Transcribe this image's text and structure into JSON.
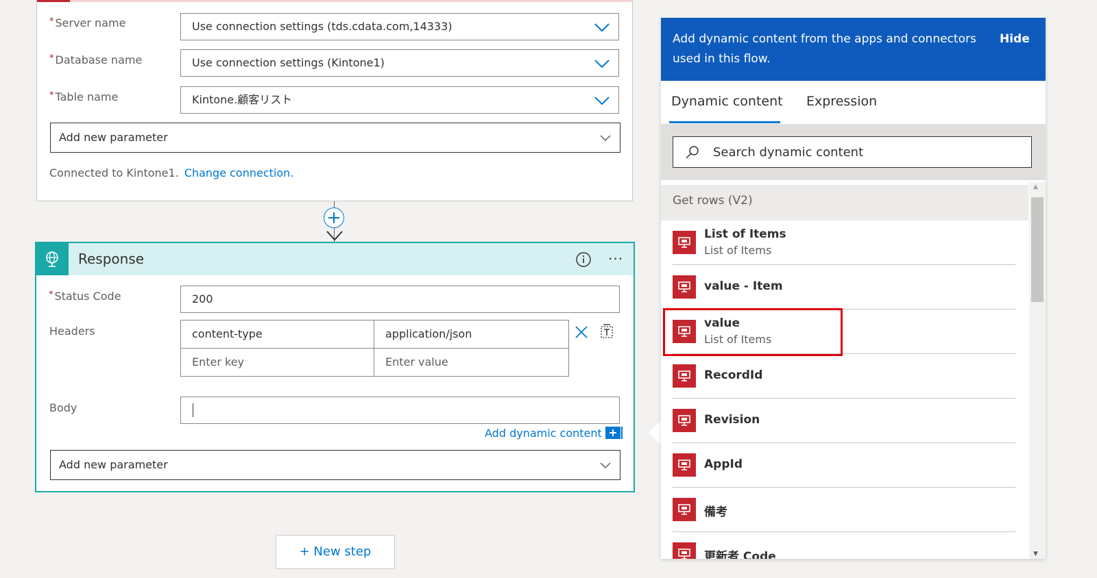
{
  "get_rows_card": {
    "server_label": "Server name",
    "server_value": "Use connection settings (tds.cdata.com,14333)",
    "database_label": "Database name",
    "database_value": "Use connection settings (Kintone1)",
    "table_label": "Table name",
    "table_value": "Kintone.顧客リスト",
    "add_param": "Add new parameter",
    "connected_text": "Connected to Kintone1.",
    "change_connection": "Change connection.",
    "required_mark": "*"
  },
  "response_card": {
    "title": "Response",
    "more": "···",
    "status_label": "Status Code",
    "status_value": "200",
    "headers_label": "Headers",
    "header_key": "content-type",
    "header_value": "application/json",
    "key_placeholder": "Enter key",
    "value_placeholder": "Enter value",
    "body_label": "Body",
    "add_dynamic": "Add dynamic content",
    "add_param": "Add new parameter",
    "required_mark": "*"
  },
  "new_step": "+ New step",
  "panel": {
    "description": "Add dynamic content from the apps and connectors used in this flow.",
    "hide": "Hide",
    "tabs": [
      "Dynamic content",
      "Expression"
    ],
    "search_placeholder": "Search dynamic content",
    "group_title": "Get rows (V2)",
    "items": [
      {
        "title": "List of Items",
        "subtitle": "List of Items"
      },
      {
        "title": "value - Item",
        "subtitle": ""
      },
      {
        "title": "value",
        "subtitle": "List of Items"
      },
      {
        "title": "RecordId",
        "subtitle": ""
      },
      {
        "title": "Revision",
        "subtitle": ""
      },
      {
        "title": "AppId",
        "subtitle": ""
      },
      {
        "title": "備考",
        "subtitle": ""
      },
      {
        "title": "更新者 Code",
        "subtitle": ""
      }
    ]
  },
  "colors": {
    "accent": "#0078d4",
    "panel_header": "#0f5bbd",
    "response_teal": "#1ba8a8",
    "sql_red": "#c4262e",
    "highlight_red": "#e00010"
  }
}
